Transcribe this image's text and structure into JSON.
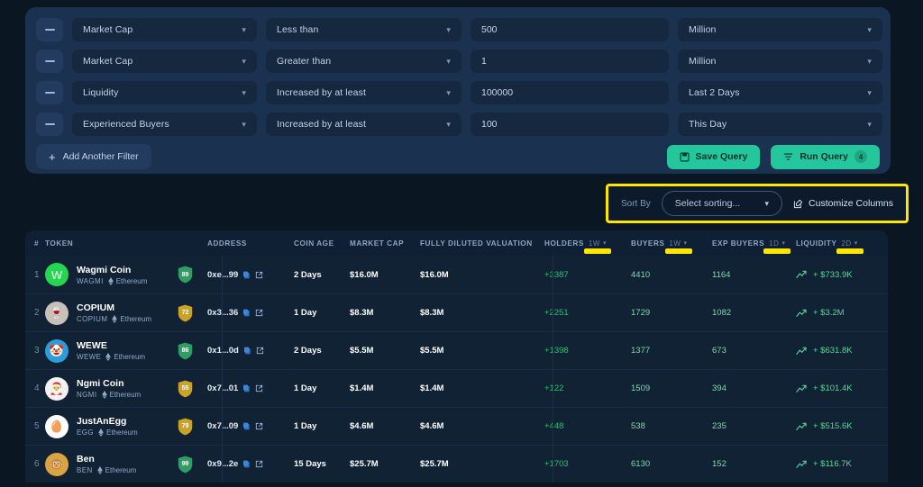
{
  "filters": {
    "rows": [
      {
        "field": "Market Cap",
        "operator": "Less than",
        "value": "500",
        "unit": "Million"
      },
      {
        "field": "Market Cap",
        "operator": "Greater than",
        "value": "1",
        "unit": "Million"
      },
      {
        "field": "Liquidity",
        "operator": "Increased by at least",
        "value": "100000",
        "unit": "Last 2 Days"
      },
      {
        "field": "Experienced Buyers",
        "operator": "Increased by at least",
        "value": "100",
        "unit": "This Day"
      }
    ],
    "add_filter_label": "Add Another Filter",
    "save_query_label": "Save Query",
    "run_query_label": "Run Query",
    "run_query_count": "4"
  },
  "sort_bar": {
    "label": "Sort By",
    "select_value": "Select sorting...",
    "customize_label": "Customize Columns"
  },
  "table": {
    "headers": {
      "rank": "#",
      "token": "TOKEN",
      "address": "ADDRESS",
      "coin_age": "COIN AGE",
      "market_cap": "MARKET CAP",
      "fdv": "FULLY DILUTED VALUATION",
      "holders": "HOLDERS",
      "holders_period": "1W",
      "buyers": "BUYERS",
      "buyers_period": "1W",
      "exp_buyers": "EXP BUYERS",
      "exp_buyers_period": "1D",
      "liquidity": "LIQUIDITY",
      "liquidity_period": "2D"
    },
    "rows": [
      {
        "rank": "1",
        "name": "Wagmi Coin",
        "symbol": "WAGMI",
        "chain": "Ethereum",
        "score": "89",
        "score_color": "#2f9e63",
        "avatar_bg": "#26d651",
        "avatar_glyph": "W",
        "avatar_fg": "#ffffff",
        "address": "0xe...99",
        "coin_age": "2 Days",
        "market_cap": "$16.0M",
        "fdv": "$16.0M",
        "holders": "+3387",
        "buyers": "4410",
        "exp_buyers": "1164",
        "liquidity": "+ $733.9K"
      },
      {
        "rank": "2",
        "name": "COPIUM",
        "symbol": "COPIUM",
        "chain": "Ethereum",
        "score": "72",
        "score_color": "#c9a227",
        "avatar_bg": "#c9c0b8",
        "avatar_glyph": "🍷",
        "avatar_fg": "#7a2020",
        "address": "0x3...36",
        "coin_age": "1 Day",
        "market_cap": "$8.3M",
        "fdv": "$8.3M",
        "holders": "+2251",
        "buyers": "1729",
        "exp_buyers": "1082",
        "liquidity": "+ $3.2M"
      },
      {
        "rank": "3",
        "name": "WEWE",
        "symbol": "WEWE",
        "chain": "Ethereum",
        "score": "86",
        "score_color": "#2f9e63",
        "avatar_bg": "#2d9cdb",
        "avatar_glyph": "🤡",
        "avatar_fg": "#ffffff",
        "address": "0x1...0d",
        "coin_age": "2 Days",
        "market_cap": "$5.5M",
        "fdv": "$5.5M",
        "holders": "+1398",
        "buyers": "1377",
        "exp_buyers": "673",
        "liquidity": "+ $631.8K"
      },
      {
        "rank": "4",
        "name": "Ngmi Coin",
        "symbol": "NGMI",
        "chain": "Ethereum",
        "score": "55",
        "score_color": "#c9a227",
        "avatar_bg": "#f2f2f2",
        "avatar_glyph": "🎅",
        "avatar_fg": "#c0392b",
        "address": "0x7...01",
        "coin_age": "1 Day",
        "market_cap": "$1.4M",
        "fdv": "$1.4M",
        "holders": "+122",
        "buyers": "1509",
        "exp_buyers": "394",
        "liquidity": "+ $101.4K"
      },
      {
        "rank": "5",
        "name": "JustAnEgg",
        "symbol": "EGG",
        "chain": "Ethereum",
        "score": "79",
        "score_color": "#c9a227",
        "avatar_bg": "#ffffff",
        "avatar_glyph": "🥚",
        "avatar_fg": "#e8b27d",
        "address": "0x7...09",
        "coin_age": "1 Day",
        "market_cap": "$4.6M",
        "fdv": "$4.6M",
        "holders": "+448",
        "buyers": "538",
        "exp_buyers": "235",
        "liquidity": "+ $515.6K"
      },
      {
        "rank": "6",
        "name": "Ben",
        "symbol": "BEN",
        "chain": "Ethereum",
        "score": "99",
        "score_color": "#2f9e63",
        "avatar_bg": "#d9a441",
        "avatar_glyph": "🐵",
        "avatar_fg": "#ffffff",
        "address": "0x9...2e",
        "coin_age": "15 Days",
        "market_cap": "$25.7M",
        "fdv": "$25.7M",
        "holders": "+1703",
        "buyers": "6130",
        "exp_buyers": "152",
        "liquidity": "+ $116.7K"
      }
    ]
  },
  "colors": {
    "page_bg": "#0b1623",
    "panel_bg": "#1b3150",
    "input_bg": "#15283f",
    "accent_teal": "#24c79b",
    "highlight_yellow": "#ffe600",
    "positive_green": "#2fbf71"
  }
}
